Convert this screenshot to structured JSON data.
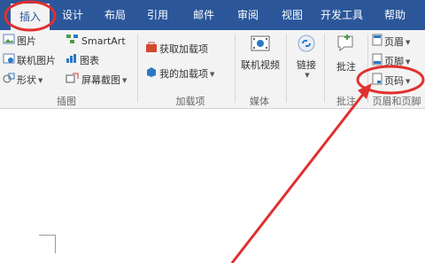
{
  "tabs": [
    {
      "label": "插入",
      "active": true
    },
    {
      "label": "设计"
    },
    {
      "label": "布局"
    },
    {
      "label": "引用"
    },
    {
      "label": "邮件"
    },
    {
      "label": "审阅"
    },
    {
      "label": "视图"
    },
    {
      "label": "开发工具"
    },
    {
      "label": "帮助"
    }
  ],
  "ribbon": {
    "illustrations": {
      "label": "插图",
      "picture": "图片",
      "online_picture": "联机图片",
      "shapes": "形状",
      "smartart": "SmartArt",
      "chart": "图表",
      "screenshot": "屏幕截图"
    },
    "addins": {
      "label": "加载项",
      "get_addins": "获取加载项",
      "my_addins": "我的加载项"
    },
    "media": {
      "label": "媒体",
      "online_video": "联机视频"
    },
    "links": {
      "link": "链接"
    },
    "comments": {
      "label": "批注",
      "comment": "批注"
    },
    "header_footer": {
      "label": "页眉和页脚",
      "header": "页眉",
      "footer": "页脚",
      "page_number": "页码"
    }
  },
  "colors": {
    "ribbon_tab_bar": "#2b579a",
    "highlight_annotation": "#e03030",
    "ribbon_bg": "#f3f3f3"
  }
}
